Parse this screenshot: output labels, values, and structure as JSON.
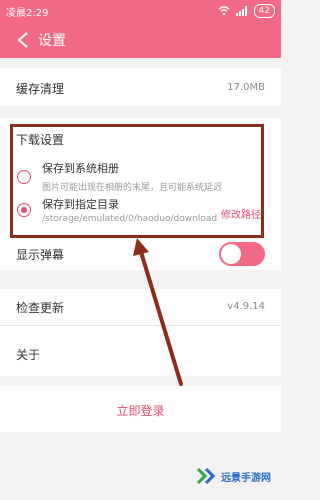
{
  "statusbar": {
    "time": "凌晨2:29",
    "battery": "42"
  },
  "header": {
    "title": "设置"
  },
  "cache": {
    "label": "缓存清理",
    "value": "17.0MB"
  },
  "download": {
    "section_title": "下载设置",
    "option1": {
      "title": "保存到系统相册",
      "desc": "图片可能出现在相册的末尾，且可能系统延迟"
    },
    "option2": {
      "title": "保存到指定目录",
      "path": "/storage/emulated/0/haoduo/download",
      "action": "修改路径"
    }
  },
  "danmaku": {
    "label": "显示弹幕"
  },
  "update": {
    "label": "检查更新",
    "value": "v4.9.14"
  },
  "about": {
    "label": "关于"
  },
  "login": {
    "label": "立即登录"
  },
  "watermark": {
    "text": "远景手游网"
  },
  "colors": {
    "accent": "#f26a85",
    "highlight": "#8b2d1a"
  }
}
